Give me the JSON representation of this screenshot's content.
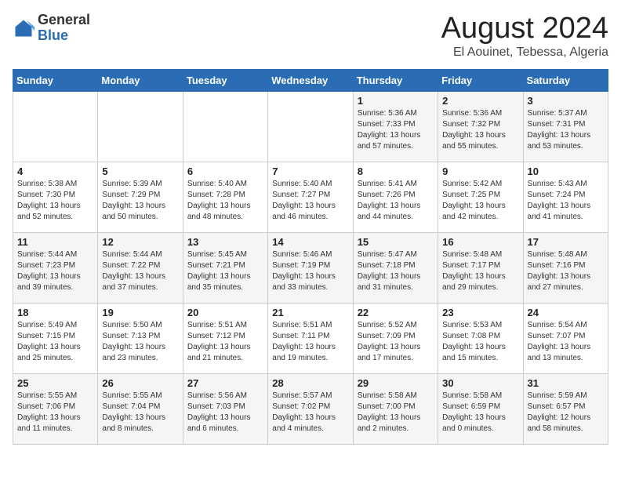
{
  "header": {
    "logo_general": "General",
    "logo_blue": "Blue",
    "month": "August 2024",
    "location": "El Aouinet, Tebessa, Algeria"
  },
  "weekdays": [
    "Sunday",
    "Monday",
    "Tuesday",
    "Wednesday",
    "Thursday",
    "Friday",
    "Saturday"
  ],
  "weeks": [
    [
      {
        "day": "",
        "info": ""
      },
      {
        "day": "",
        "info": ""
      },
      {
        "day": "",
        "info": ""
      },
      {
        "day": "",
        "info": ""
      },
      {
        "day": "1",
        "info": "Sunrise: 5:36 AM\nSunset: 7:33 PM\nDaylight: 13 hours\nand 57 minutes."
      },
      {
        "day": "2",
        "info": "Sunrise: 5:36 AM\nSunset: 7:32 PM\nDaylight: 13 hours\nand 55 minutes."
      },
      {
        "day": "3",
        "info": "Sunrise: 5:37 AM\nSunset: 7:31 PM\nDaylight: 13 hours\nand 53 minutes."
      }
    ],
    [
      {
        "day": "4",
        "info": "Sunrise: 5:38 AM\nSunset: 7:30 PM\nDaylight: 13 hours\nand 52 minutes."
      },
      {
        "day": "5",
        "info": "Sunrise: 5:39 AM\nSunset: 7:29 PM\nDaylight: 13 hours\nand 50 minutes."
      },
      {
        "day": "6",
        "info": "Sunrise: 5:40 AM\nSunset: 7:28 PM\nDaylight: 13 hours\nand 48 minutes."
      },
      {
        "day": "7",
        "info": "Sunrise: 5:40 AM\nSunset: 7:27 PM\nDaylight: 13 hours\nand 46 minutes."
      },
      {
        "day": "8",
        "info": "Sunrise: 5:41 AM\nSunset: 7:26 PM\nDaylight: 13 hours\nand 44 minutes."
      },
      {
        "day": "9",
        "info": "Sunrise: 5:42 AM\nSunset: 7:25 PM\nDaylight: 13 hours\nand 42 minutes."
      },
      {
        "day": "10",
        "info": "Sunrise: 5:43 AM\nSunset: 7:24 PM\nDaylight: 13 hours\nand 41 minutes."
      }
    ],
    [
      {
        "day": "11",
        "info": "Sunrise: 5:44 AM\nSunset: 7:23 PM\nDaylight: 13 hours\nand 39 minutes."
      },
      {
        "day": "12",
        "info": "Sunrise: 5:44 AM\nSunset: 7:22 PM\nDaylight: 13 hours\nand 37 minutes."
      },
      {
        "day": "13",
        "info": "Sunrise: 5:45 AM\nSunset: 7:21 PM\nDaylight: 13 hours\nand 35 minutes."
      },
      {
        "day": "14",
        "info": "Sunrise: 5:46 AM\nSunset: 7:19 PM\nDaylight: 13 hours\nand 33 minutes."
      },
      {
        "day": "15",
        "info": "Sunrise: 5:47 AM\nSunset: 7:18 PM\nDaylight: 13 hours\nand 31 minutes."
      },
      {
        "day": "16",
        "info": "Sunrise: 5:48 AM\nSunset: 7:17 PM\nDaylight: 13 hours\nand 29 minutes."
      },
      {
        "day": "17",
        "info": "Sunrise: 5:48 AM\nSunset: 7:16 PM\nDaylight: 13 hours\nand 27 minutes."
      }
    ],
    [
      {
        "day": "18",
        "info": "Sunrise: 5:49 AM\nSunset: 7:15 PM\nDaylight: 13 hours\nand 25 minutes."
      },
      {
        "day": "19",
        "info": "Sunrise: 5:50 AM\nSunset: 7:13 PM\nDaylight: 13 hours\nand 23 minutes."
      },
      {
        "day": "20",
        "info": "Sunrise: 5:51 AM\nSunset: 7:12 PM\nDaylight: 13 hours\nand 21 minutes."
      },
      {
        "day": "21",
        "info": "Sunrise: 5:51 AM\nSunset: 7:11 PM\nDaylight: 13 hours\nand 19 minutes."
      },
      {
        "day": "22",
        "info": "Sunrise: 5:52 AM\nSunset: 7:09 PM\nDaylight: 13 hours\nand 17 minutes."
      },
      {
        "day": "23",
        "info": "Sunrise: 5:53 AM\nSunset: 7:08 PM\nDaylight: 13 hours\nand 15 minutes."
      },
      {
        "day": "24",
        "info": "Sunrise: 5:54 AM\nSunset: 7:07 PM\nDaylight: 13 hours\nand 13 minutes."
      }
    ],
    [
      {
        "day": "25",
        "info": "Sunrise: 5:55 AM\nSunset: 7:06 PM\nDaylight: 13 hours\nand 11 minutes."
      },
      {
        "day": "26",
        "info": "Sunrise: 5:55 AM\nSunset: 7:04 PM\nDaylight: 13 hours\nand 8 minutes."
      },
      {
        "day": "27",
        "info": "Sunrise: 5:56 AM\nSunset: 7:03 PM\nDaylight: 13 hours\nand 6 minutes."
      },
      {
        "day": "28",
        "info": "Sunrise: 5:57 AM\nSunset: 7:02 PM\nDaylight: 13 hours\nand 4 minutes."
      },
      {
        "day": "29",
        "info": "Sunrise: 5:58 AM\nSunset: 7:00 PM\nDaylight: 13 hours\nand 2 minutes."
      },
      {
        "day": "30",
        "info": "Sunrise: 5:58 AM\nSunset: 6:59 PM\nDaylight: 13 hours\nand 0 minutes."
      },
      {
        "day": "31",
        "info": "Sunrise: 5:59 AM\nSunset: 6:57 PM\nDaylight: 12 hours\nand 58 minutes."
      }
    ]
  ]
}
